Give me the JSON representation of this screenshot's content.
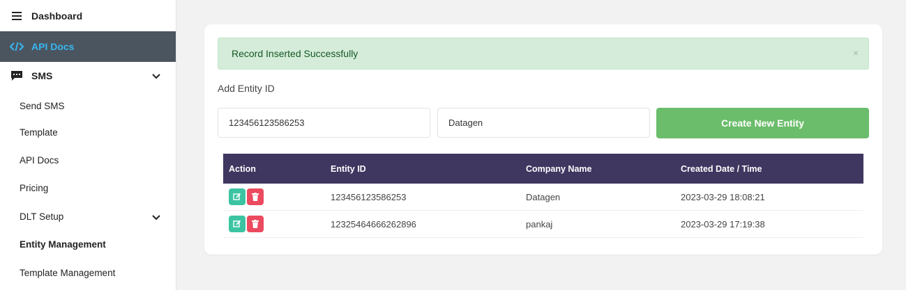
{
  "sidebar": {
    "dashboard": "Dashboard",
    "api_docs": "API Docs",
    "sms": "SMS",
    "sub_items": [
      "Send SMS",
      "Template",
      "API Docs",
      "Pricing",
      "DLT Setup",
      "Entity Management",
      "Template Management"
    ],
    "active_sub": "Entity Management"
  },
  "alert": {
    "message": "Record Inserted Successfully",
    "close": "×"
  },
  "form": {
    "section_label": "Add Entity ID",
    "entity_id_value": "123456123586253",
    "company_value": "Datagen",
    "create_button": "Create New Entity"
  },
  "table": {
    "headers": [
      "Action",
      "Entity ID",
      "Company Name",
      "Created Date / Time"
    ],
    "rows": [
      {
        "entity_id": "123456123586253",
        "company": "Datagen",
        "created": "2023-03-29 18:08:21"
      },
      {
        "entity_id": "12325464666262896",
        "company": "pankaj",
        "created": "2023-03-29 17:19:38"
      }
    ]
  },
  "colors": {
    "sidebar_active_bg": "#4b5560",
    "sidebar_active_text": "#38b6f0",
    "alert_bg": "#d4ecd9",
    "create_button": "#6bbd6b",
    "table_header": "#3f3760",
    "edit_button": "#3cc4a2",
    "delete_button": "#eb4a5f"
  },
  "icons": {
    "dashboard": "hamburger-icon",
    "api_docs": "code-icon",
    "sms": "chat-icon",
    "expand": "chevron-down-icon",
    "edit": "edit-icon",
    "delete": "trash-icon"
  }
}
